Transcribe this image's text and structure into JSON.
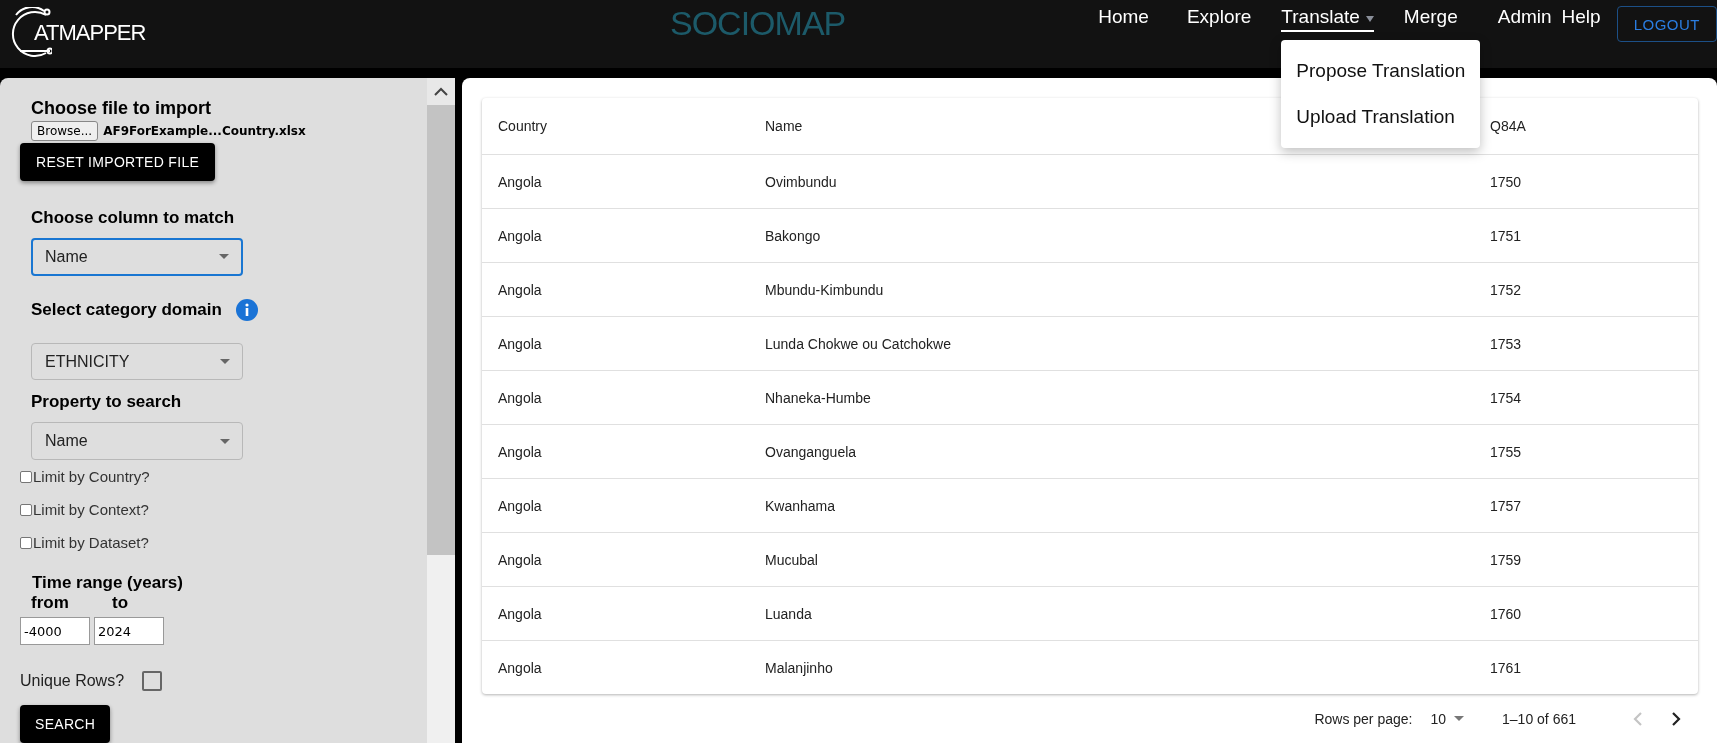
{
  "header": {
    "logo": "ATMAPPER",
    "brand": "SOCIOMAP",
    "nav": [
      {
        "label": "Home",
        "kind": "link",
        "selected": false
      },
      {
        "label": "Explore",
        "kind": "link",
        "selected": false
      },
      {
        "label": "Translate",
        "kind": "dropdown",
        "selected": true,
        "expanded": true,
        "menu": [
          "Propose Translation",
          "Upload Translation"
        ]
      },
      {
        "label": "Merge",
        "kind": "link",
        "selected": false
      },
      {
        "label": "Admin",
        "kind": "link",
        "selected": false
      },
      {
        "label": "Help",
        "kind": "link",
        "selected": false
      }
    ],
    "logout": "LOGOUT"
  },
  "import_panel": {
    "title": "Choose file to import",
    "browse": "Browse...",
    "file_name": "AF9ForExample...Country.xlsx",
    "reset": "RESET IMPORTED FILE",
    "fields": [
      {
        "label": "Choose column to match",
        "value": "Name",
        "focused": true,
        "info": false
      },
      {
        "label": "Select category domain",
        "value": "ETHNICITY",
        "focused": false,
        "info": true
      },
      {
        "label": "Property to search",
        "value": "Name",
        "focused": false,
        "info": false
      }
    ],
    "limits": [
      {
        "label": "Limit by Country?",
        "checked": false
      },
      {
        "label": "Limit by Context?",
        "checked": false
      },
      {
        "label": "Limit by Dataset?",
        "checked": false
      }
    ],
    "time_range": {
      "title": "Time range (years)",
      "from_label": "from",
      "to_label": "to",
      "from": "-4000",
      "to": "2024"
    },
    "unique_rows": {
      "label": "Unique Rows?",
      "checked": false
    },
    "search": "SEARCH"
  },
  "table": {
    "columns": [
      "Country",
      "Name",
      "Q84A"
    ],
    "rows": [
      [
        "Angola",
        "Ovimbundu",
        "1750"
      ],
      [
        "Angola",
        "Bakongo",
        "1751"
      ],
      [
        "Angola",
        "Mbundu-Kimbundu",
        "1752"
      ],
      [
        "Angola",
        "Lunda Chokwe ou Catchokwe",
        "1753"
      ],
      [
        "Angola",
        "Nhaneka-Humbe",
        "1754"
      ],
      [
        "Angola",
        "Ovanganguela",
        "1755"
      ],
      [
        "Angola",
        "Kwanhama",
        "1757"
      ],
      [
        "Angola",
        "Mucubal",
        "1759"
      ],
      [
        "Angola",
        "Luanda",
        "1760"
      ],
      [
        "Angola",
        "Malanjinho",
        "1761"
      ]
    ]
  },
  "pagination": {
    "rows_label": "Rows per page:",
    "rows_value": "10",
    "range": "1–10 of 661",
    "prev_disabled": true,
    "next_disabled": false
  }
}
